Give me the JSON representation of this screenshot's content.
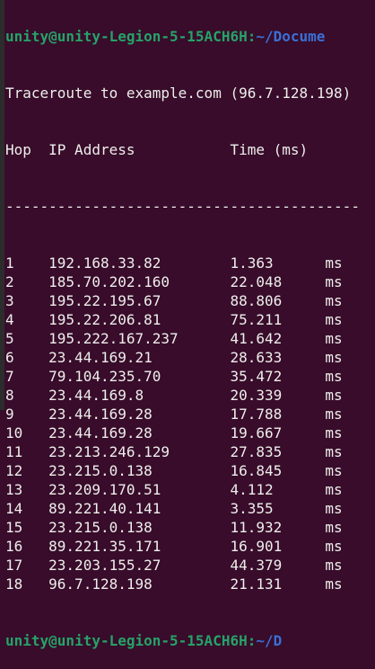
{
  "prompt_top": {
    "user_host": "unity@unity-Legion-5-15ACH6H:",
    "path": "~/Docume"
  },
  "title": "Traceroute to example.com (96.7.128.198)",
  "header": {
    "hop": "Hop",
    "ip": "IP Address",
    "time": "Time (ms)"
  },
  "separator": "-----------------------------------------",
  "rows": [
    {
      "hop": "1",
      "ip": "192.168.33.82",
      "time": "1.363",
      "unit": "ms"
    },
    {
      "hop": "2",
      "ip": "185.70.202.160",
      "time": "22.048",
      "unit": "ms"
    },
    {
      "hop": "3",
      "ip": "195.22.195.67",
      "time": "88.806",
      "unit": "ms"
    },
    {
      "hop": "4",
      "ip": "195.22.206.81",
      "time": "75.211",
      "unit": "ms"
    },
    {
      "hop": "5",
      "ip": "195.222.167.237",
      "time": "41.642",
      "unit": "ms"
    },
    {
      "hop": "6",
      "ip": "23.44.169.21",
      "time": "28.633",
      "unit": "ms"
    },
    {
      "hop": "7",
      "ip": "79.104.235.70",
      "time": "35.472",
      "unit": "ms"
    },
    {
      "hop": "8",
      "ip": "23.44.169.8",
      "time": "20.339",
      "unit": "ms"
    },
    {
      "hop": "9",
      "ip": "23.44.169.28",
      "time": "17.788",
      "unit": "ms"
    },
    {
      "hop": "10",
      "ip": "23.44.169.28",
      "time": "19.667",
      "unit": "ms"
    },
    {
      "hop": "11",
      "ip": "23.213.246.129",
      "time": "27.835",
      "unit": "ms"
    },
    {
      "hop": "12",
      "ip": "23.215.0.138",
      "time": "16.845",
      "unit": "ms"
    },
    {
      "hop": "13",
      "ip": "23.209.170.51",
      "time": "4.112",
      "unit": "ms"
    },
    {
      "hop": "14",
      "ip": "89.221.40.141",
      "time": "3.355",
      "unit": "ms"
    },
    {
      "hop": "15",
      "ip": "23.215.0.138",
      "time": "11.932",
      "unit": "ms"
    },
    {
      "hop": "16",
      "ip": "89.221.35.171",
      "time": "16.901",
      "unit": "ms"
    },
    {
      "hop": "17",
      "ip": "23.203.155.27",
      "time": "44.379",
      "unit": "ms"
    },
    {
      "hop": "18",
      "ip": "96.7.128.198",
      "time": "21.131",
      "unit": "ms"
    }
  ],
  "prompt_bottom": {
    "user_host": "unity@unity-Legion-5-15ACH6H:",
    "path": "~/D"
  }
}
